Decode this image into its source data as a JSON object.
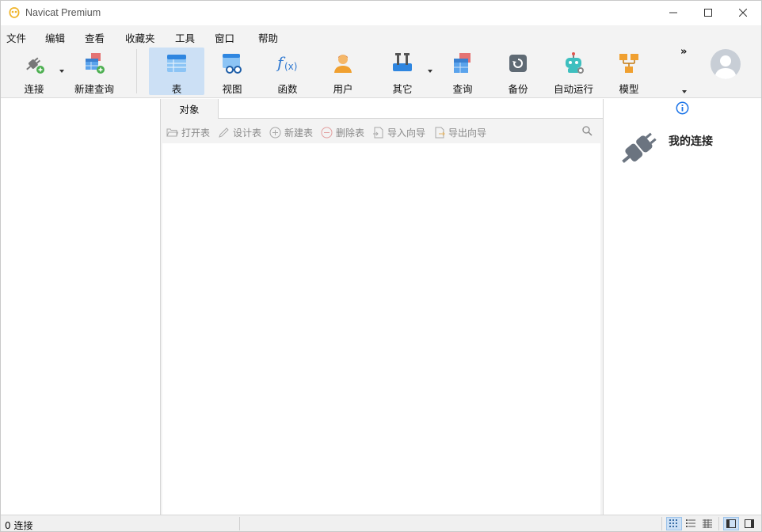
{
  "app": {
    "title": "Navicat Premium"
  },
  "menu": [
    "文件",
    "编辑",
    "查看",
    "收藏夹",
    "工具",
    "窗口",
    "帮助"
  ],
  "toolbar": {
    "connect": "连接",
    "new_query": "新建查询",
    "table": "表",
    "view": "视图",
    "function": "函数",
    "user": "用户",
    "other": "其它",
    "query": "查询",
    "backup": "备份",
    "automation": "自动运行",
    "model": "模型",
    "more": "»"
  },
  "tabs": {
    "objects": "对象"
  },
  "object_toolbar": {
    "open_table": "打开表",
    "design_table": "设计表",
    "new_table": "新建表",
    "delete_table": "删除表",
    "import_wizard": "导入向导",
    "export_wizard": "导出向导"
  },
  "right_panel": {
    "title": "我的连接"
  },
  "status": {
    "connections": "0 连接"
  },
  "colors": {
    "accent": "#cce0f5",
    "icon_blue": "#3a8ee6",
    "icon_green": "#4caf50"
  }
}
